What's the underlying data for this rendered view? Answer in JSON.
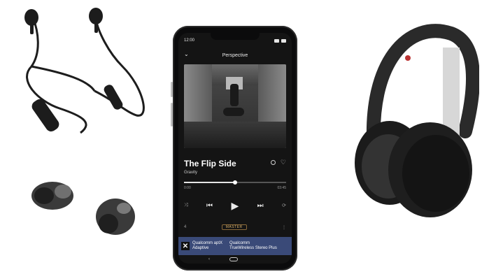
{
  "phone": {
    "status_time": "12:00",
    "header_title": "Perspective",
    "song_title": "The Flip Side",
    "song_artist": "Gravity",
    "time_elapsed": "0:00",
    "time_total": "03:45",
    "progress": 0.5,
    "bottom_left_count": "4",
    "master_label": "MASTER",
    "banner_left_line1": "Qualcomm aptX",
    "banner_left_line2": "Adaptive",
    "banner_right_line1": "Qualcomm",
    "banner_right_line2": "TrueWireless Stereo Plus"
  },
  "icons": {
    "chevron": "chevron-down-icon",
    "info": "info-icon",
    "heart": "heart-icon",
    "shuffle": "shuffle-icon",
    "prev": "previous-icon",
    "play": "play-icon",
    "next": "next-icon",
    "repeat": "repeat-icon"
  },
  "colors": {
    "banner": "#3a4a78",
    "master_text": "#d8b06a"
  }
}
